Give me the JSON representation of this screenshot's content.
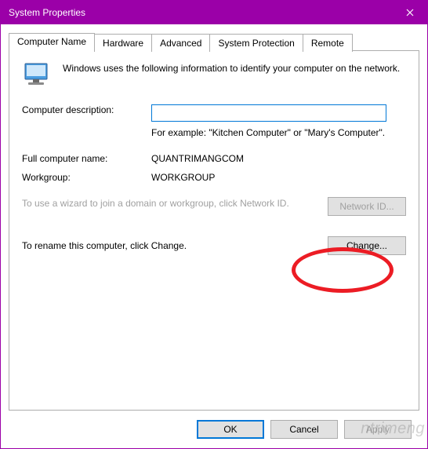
{
  "window": {
    "title": "System Properties"
  },
  "tabs": {
    "computer_name": "Computer Name",
    "hardware": "Hardware",
    "advanced": "Advanced",
    "system_protection": "System Protection",
    "remote": "Remote"
  },
  "intro": "Windows uses the following information to identify your computer on the network.",
  "desc": {
    "label": "Computer description:",
    "value": "",
    "example": "For example: \"Kitchen Computer\" or \"Mary's Computer\"."
  },
  "full_name": {
    "label": "Full computer name:",
    "value": "QUANTRIMANGCOM"
  },
  "workgroup": {
    "label": "Workgroup:",
    "value": "WORKGROUP"
  },
  "wizard_text": "To use a wizard to join a domain or workgroup, click Network ID.",
  "rename_text": "To rename this computer, click Change.",
  "buttons": {
    "network_id": "Network ID...",
    "change": "Change...",
    "ok": "OK",
    "cancel": "Cancel",
    "apply": "Apply"
  },
  "watermark": "ntrimeng"
}
